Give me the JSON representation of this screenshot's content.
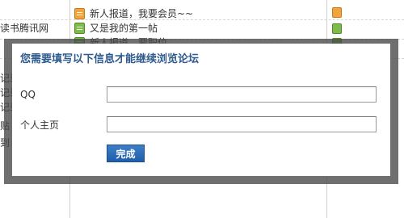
{
  "background": {
    "left_column": [
      {
        "text": "读书腾讯网",
        "row": 1
      },
      {
        "text": "记录",
        "row": 3
      },
      {
        "text": "记录",
        "row": 4
      },
      {
        "text": "记录",
        "row": 5
      },
      {
        "text": "贴",
        "row": 6
      },
      {
        "text": "到",
        "row": 7
      }
    ],
    "threads": [
      {
        "title": "新人报道，我要会员~~",
        "icon": "orange"
      },
      {
        "title": "又是我的第一帖",
        "icon": "green"
      },
      {
        "title": "新人报道，要职位",
        "icon": "green"
      }
    ]
  },
  "dialog": {
    "title": "您需要填写以下信息才能继续浏览论坛",
    "fields": [
      {
        "label": "QQ",
        "value": ""
      },
      {
        "label": "个人主页",
        "value": ""
      }
    ],
    "submit_label": "完成"
  }
}
